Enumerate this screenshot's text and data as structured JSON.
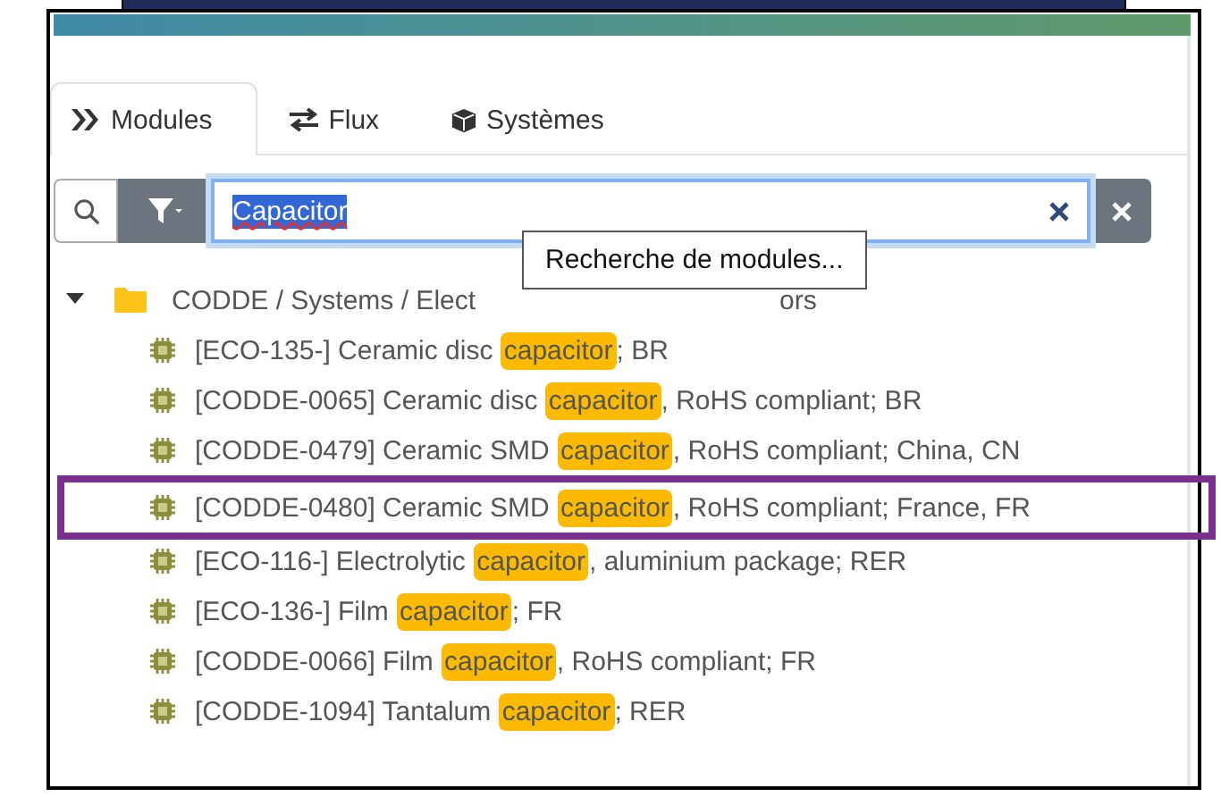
{
  "tabs": [
    {
      "label": "Modules",
      "kind": "modules",
      "selected": true
    },
    {
      "label": "Flux",
      "kind": "flux",
      "selected": false
    },
    {
      "label": "Systèmes",
      "kind": "systems",
      "selected": false
    }
  ],
  "search": {
    "value": "Capacitor",
    "value_selected": true,
    "tooltip": "Recherche de modules..."
  },
  "tree": {
    "root": {
      "label_start": "CODDE / Systems / Elect",
      "label_end": "ors",
      "expanded": true,
      "children": [
        {
          "code": "[ECO-135-]",
          "before": "Ceramic disc",
          "match": "capacitor",
          "after": "; BR",
          "framed": false
        },
        {
          "code": "[CODDE-0065]",
          "before": "Ceramic disc",
          "match": "capacitor",
          "after": ", RoHS compliant; BR",
          "framed": false
        },
        {
          "code": "[CODDE-0479]",
          "before": "Ceramic SMD",
          "match": "capacitor",
          "after": ", RoHS compliant; China, CN",
          "framed": false
        },
        {
          "code": "[CODDE-0480]",
          "before": "Ceramic SMD",
          "match": "capacitor",
          "after": ", RoHS compliant; France, FR",
          "framed": true
        },
        {
          "code": "[ECO-116-]",
          "before": "Electrolytic",
          "match": "capacitor",
          "after": ", aluminium package; RER",
          "framed": false
        },
        {
          "code": "[ECO-136-]",
          "before": "Film",
          "match": "capacitor",
          "after": "; FR",
          "framed": false
        },
        {
          "code": "[CODDE-0066]",
          "before": "Film",
          "match": "capacitor",
          "after": ", RoHS compliant; FR",
          "framed": false
        },
        {
          "code": "[CODDE-1094]",
          "before": "Tantalum",
          "match": "capacitor",
          "after": "; RER",
          "framed": false
        }
      ]
    }
  }
}
